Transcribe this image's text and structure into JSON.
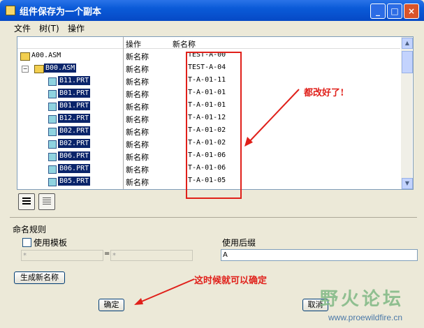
{
  "window": {
    "title": "组件保存为一个副本"
  },
  "menu": [
    "文件",
    "树(T)",
    "操作"
  ],
  "tree": {
    "headers": {
      "op": "操作",
      "newname": "新名称"
    },
    "rows": [
      {
        "name": "A00.ASM",
        "op": "新名称",
        "newname": "TEST-A-00",
        "selected": false
      },
      {
        "name": "B00.ASM",
        "op": "新名称",
        "newname": "TEST-A-04",
        "selected": true
      },
      {
        "name": "B11.PRT",
        "op": "新名称",
        "newname": "T-A-01-11",
        "selected": true
      },
      {
        "name": "B01.PRT",
        "op": "新名称",
        "newname": "T-A-01-01",
        "selected": true
      },
      {
        "name": "B01.PRT",
        "op": "新名称",
        "newname": "T-A-01-01",
        "selected": true
      },
      {
        "name": "B12.PRT",
        "op": "新名称",
        "newname": "T-A-01-12",
        "selected": true
      },
      {
        "name": "B02.PRT",
        "op": "新名称",
        "newname": "T-A-01-02",
        "selected": true
      },
      {
        "name": "B02.PRT",
        "op": "新名称",
        "newname": "T-A-01-02",
        "selected": true
      },
      {
        "name": "B06.PRT",
        "op": "新名称",
        "newname": "T-A-01-06",
        "selected": true
      },
      {
        "name": "B06.PRT",
        "op": "新名称",
        "newname": "T-A-01-06",
        "selected": true
      },
      {
        "name": "B05.PRT",
        "op": "新名称",
        "newname": "T-A-01-05",
        "selected": true
      }
    ]
  },
  "annotations": {
    "done": "都改好了!",
    "confirm": "这时候就可以确定"
  },
  "naming": {
    "section_label": "命名规则",
    "use_template": "使用模板",
    "template_left": "*",
    "template_sep": "=",
    "template_right": "*",
    "use_suffix": "使用后缀",
    "suffix_value": "A"
  },
  "buttons": {
    "generate": "生成新名称",
    "ok": "确定",
    "cancel": "取消"
  },
  "watermark": {
    "brand": "野火论坛",
    "url": "www.proewildfire.cn"
  },
  "colors": {
    "accent": "#0a246a",
    "annotation": "#e0201a"
  }
}
